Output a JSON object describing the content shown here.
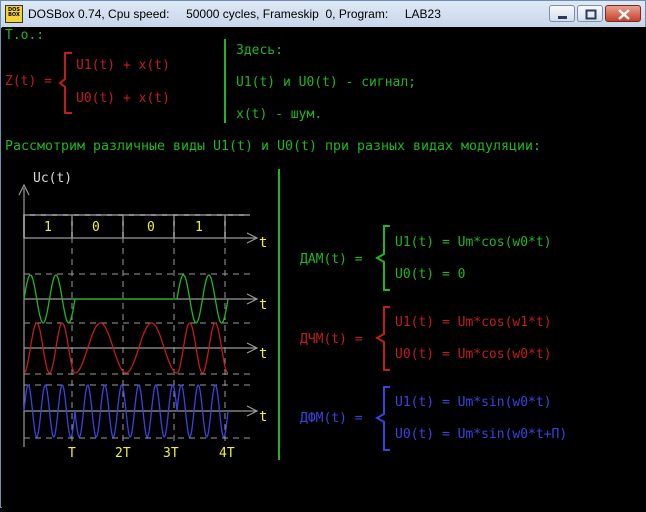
{
  "window": {
    "title": "DOSBox 0.74, Cpu speed:     50000 cycles, Frameskip  0, Program:     LAB23",
    "app_icon_text": "DOS BOX"
  },
  "colors": {
    "green": "#22b522",
    "red": "#c11d1d",
    "blue": "#3a43e0",
    "yellow": "#eef03a",
    "white": "#d8d8d8",
    "axis_gray": "#9a9a9a"
  },
  "screen": {
    "line_to": "Т.о.:",
    "z_label": "Z(t) =",
    "z_case1": "U1(t) + x(t)",
    "z_case2": "U0(t) + x(t)",
    "note_title": "Здесь:",
    "note_line1": "U1(t) и U0(t) - сигнал;",
    "note_line2": "x(t) - шум.",
    "heading": "Рассмотрим различные виды U1(t) и U0(t) при разных видах модуляции:",
    "y_axis_label": "Uc(t)",
    "t_label": "t",
    "bits": [
      "1",
      "0",
      "0",
      "1"
    ],
    "period_labels": [
      "T",
      "2T",
      "3T",
      "4T"
    ],
    "dam": {
      "label": "ДАМ(t) =",
      "u1": "U1(t) = Um*cos(w0*t)",
      "u0": "U0(t) = 0"
    },
    "dchm": {
      "label": "ДЧМ(t) =",
      "u1": "U1(t) = Um*cos(w1*t)",
      "u0": "U0(t) = Um*cos(w0*t)"
    },
    "dfm": {
      "label": "ДФМ(t) =",
      "u1": "U1(t) = Um*sin(w0*t)",
      "u0": "U0(t) = Um*sin(w0*t+П)"
    }
  }
}
